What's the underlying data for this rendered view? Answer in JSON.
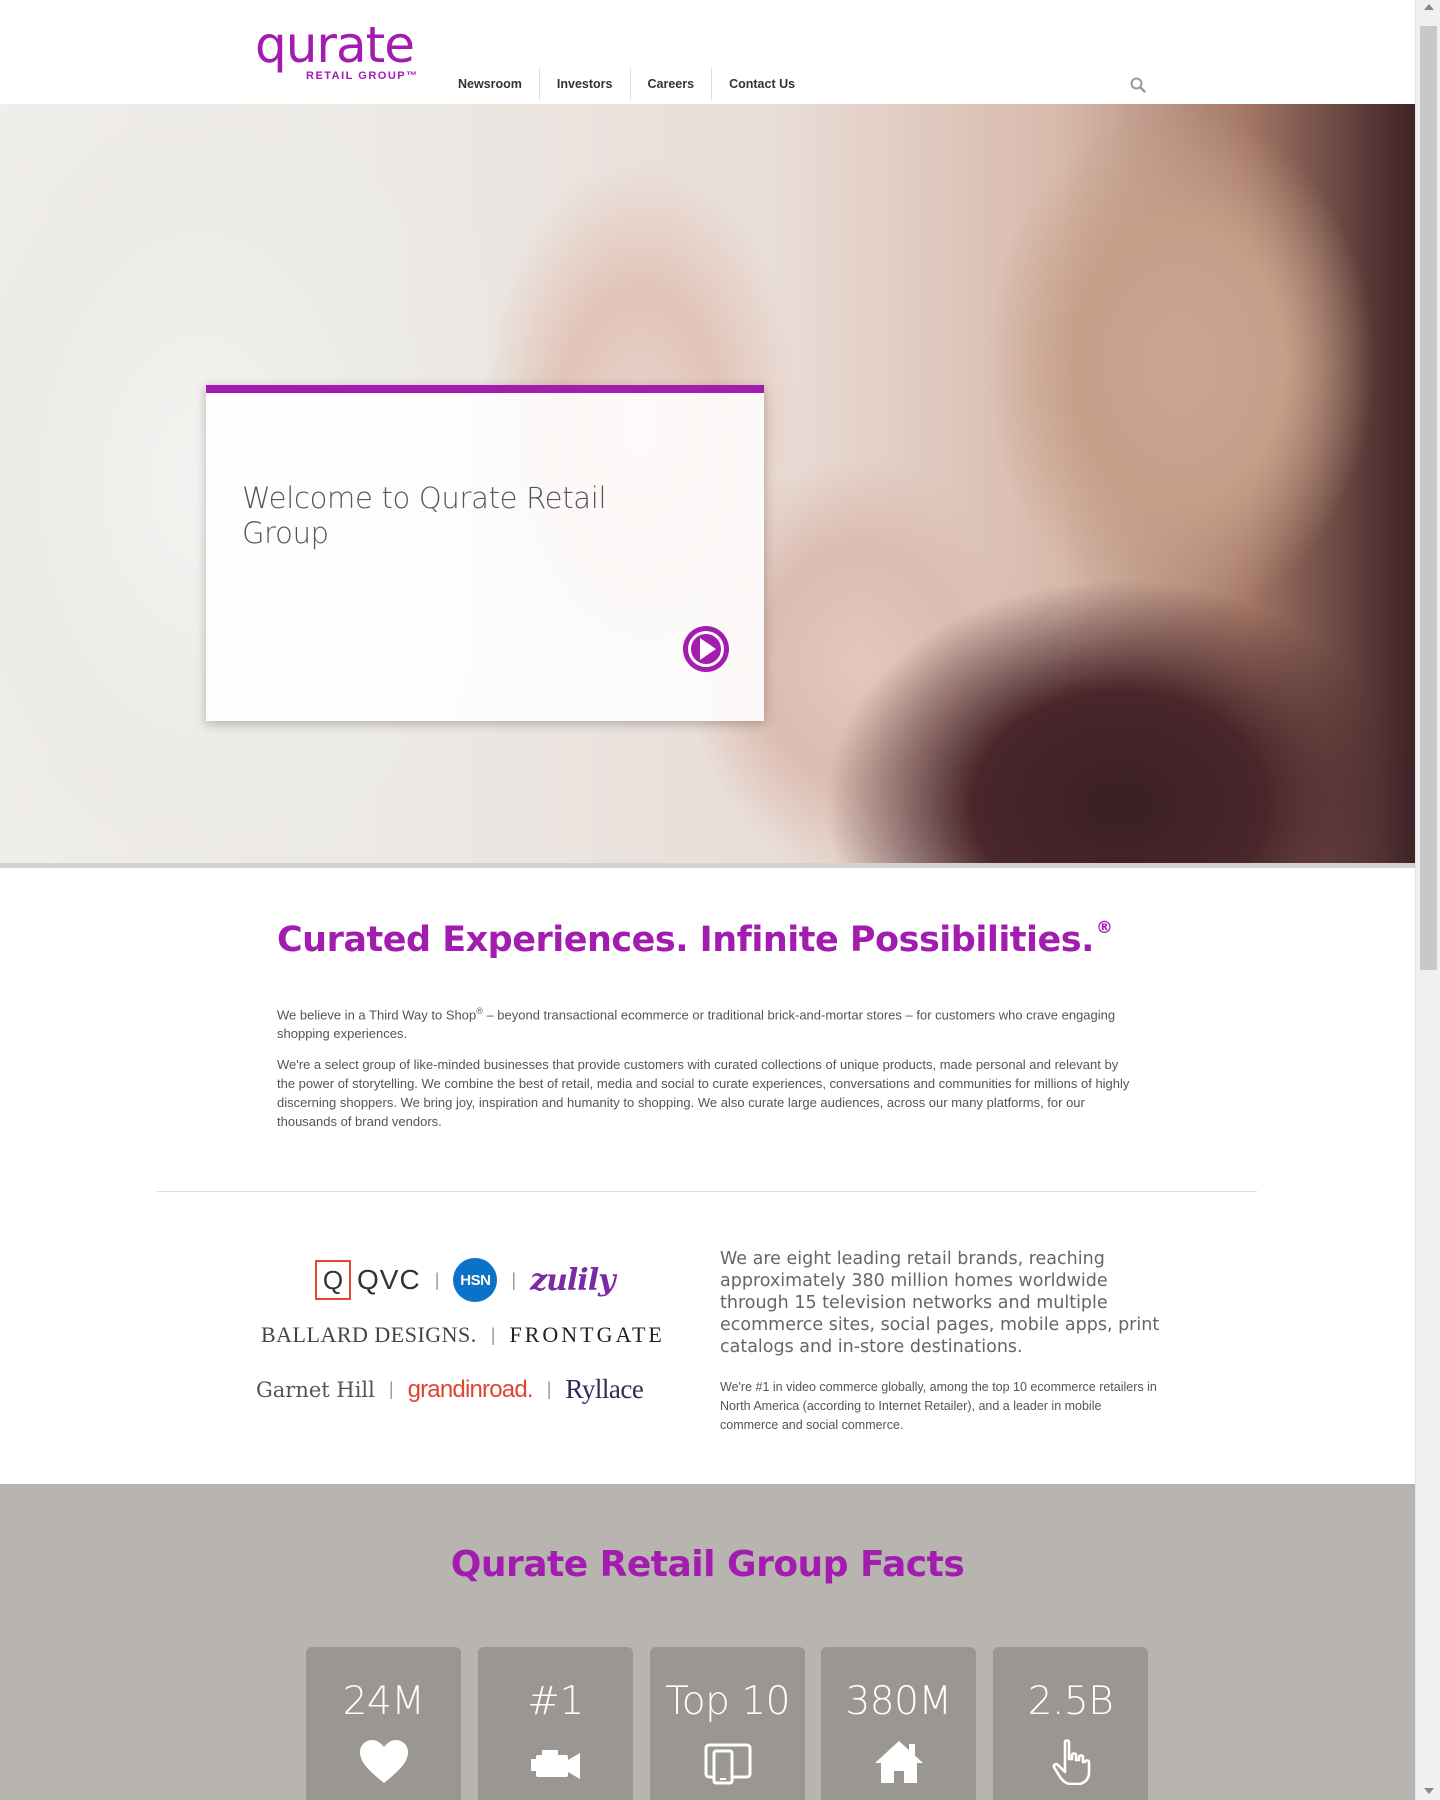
{
  "header": {
    "logo_word": "qurate",
    "logo_sub": "RETAIL GROUP™",
    "nav": [
      "Newsroom",
      "Investors",
      "Careers",
      "Contact Us"
    ]
  },
  "hero": {
    "title": "Welcome to Qurate Retail Group"
  },
  "intro": {
    "heading": "Curated Experiences. Infinite Possibilities.",
    "heading_mark": "®",
    "p1_a": "We believe in a Third Way to Shop",
    "p1_mark": "®",
    "p1_b": " – beyond transactional ecommerce or traditional brick-and-mortar stores – for customers who crave engaging shopping experiences.",
    "p2": "We're a select group of like-minded businesses that provide customers with curated collections of unique products, made personal and relevant by the power of storytelling. We combine the best of retail, media and social to curate experiences, conversations and communities for millions of highly discerning shoppers. We bring joy, inspiration and humanity to shopping. We also curate large audiences, across our many platforms, for our thousands of brand vendors."
  },
  "brands": {
    "qvc_box": "Q",
    "qvc": "QVC",
    "hsn": "HSN",
    "zulily": "zulily",
    "ballard": "BALLARD DESIGNS.",
    "frontgate": "FRONTGATE",
    "garnet": "Garnet Hill",
    "grandin": "grandinroad.",
    "ryllace": "Ryllace",
    "separator": "|",
    "lead": "We are eight leading retail brands, reaching approximately 380 million homes worldwide through 15 television networks and multiple ecommerce sites, social pages, mobile apps, print catalogs and in-store destinations.",
    "detail": "We're #1 in video commerce globally, among the top 10 ecommerce retailers in North America (according to Internet Retailer), and a leader in mobile commerce and social commerce."
  },
  "facts": {
    "title": "Qurate Retail Group Facts",
    "items": [
      {
        "value": "24M",
        "icon": "heart-icon"
      },
      {
        "value": "#1",
        "icon": "video-camera-icon"
      },
      {
        "value": "Top 10",
        "icon": "devices-icon"
      },
      {
        "value": "380M",
        "icon": "home-icon"
      },
      {
        "value": "2.5B",
        "icon": "pointing-hand-icon"
      }
    ]
  },
  "colors": {
    "brand_purple": "#a21caf",
    "facts_bg": "#b8b4b0",
    "fact_card": "#9a9691"
  }
}
